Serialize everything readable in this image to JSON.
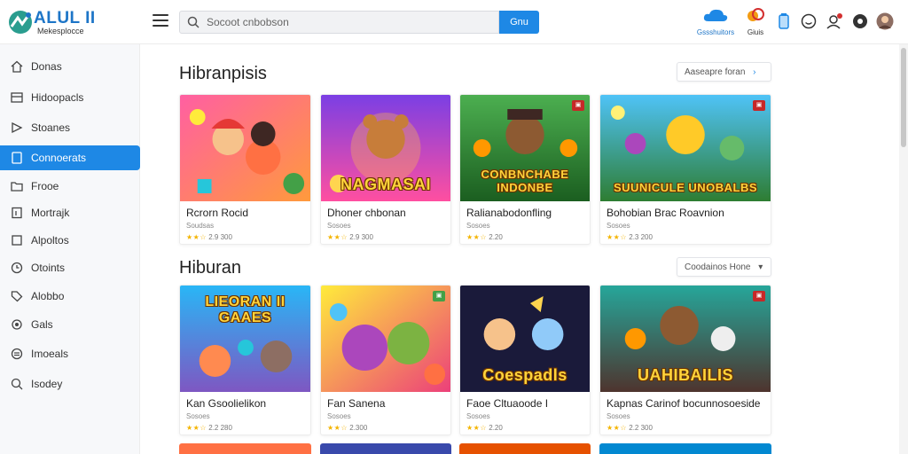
{
  "header": {
    "logo_title": "ALUL II",
    "logo_subtitle": "Mekesplocce",
    "search_placeholder": "Socoot cnbobson",
    "search_button": "Gnu",
    "cloud_label": "Gssshuitors",
    "coins_label": "Giuis"
  },
  "sidebar": {
    "items": [
      {
        "label": "Donas",
        "icon": "home-icon"
      },
      {
        "label": "Hidoopacls",
        "icon": "layout-icon"
      },
      {
        "label": "Stoanes",
        "icon": "arrow-icon"
      },
      {
        "label": "Connoerats",
        "icon": "tag-icon",
        "active": true
      },
      {
        "label": "Frooe",
        "icon": "folder-icon"
      },
      {
        "label": "Mortrajk",
        "icon": "bookmark-icon"
      },
      {
        "label": "Alpoltos",
        "icon": "square-icon"
      },
      {
        "label": "Otoints",
        "icon": "clock-icon"
      },
      {
        "label": "Alobbo",
        "icon": "tag-icon"
      },
      {
        "label": "Gals",
        "icon": "gear-icon"
      },
      {
        "label": "Imoeals",
        "icon": "list-icon"
      },
      {
        "label": "Isodey",
        "icon": "search-icon"
      }
    ]
  },
  "sections": [
    {
      "title": "Hibranpisis",
      "button": "Aaseapre foran",
      "cards": [
        {
          "name": "Rcrorn Rocid",
          "sub": "Soudsas",
          "rating": "2.9 300",
          "stars": "★★☆",
          "art_text": ""
        },
        {
          "name": "Dhoner chbonan",
          "sub": "Sosoes",
          "rating": "2.9 300",
          "stars": "★★☆",
          "art_text": "NAGMASAI"
        },
        {
          "name": "Ralianabodonfling",
          "sub": "Sosoes",
          "rating": "2.20",
          "stars": "★★☆",
          "art_text": "CONBNCHABE INDONBE"
        },
        {
          "name": "Bohobian Brac Roavnion",
          "sub": "Sosoes",
          "rating": "2.3 200",
          "stars": "★★☆",
          "art_text": "SUUNICULE UNOBALBS"
        }
      ]
    },
    {
      "title": "Hiburan",
      "button": "Coodainos Hone",
      "cards": [
        {
          "name": "Kan Gsoolielikon",
          "sub": "Sosoes",
          "rating": "2.2 280",
          "stars": "★★☆",
          "art_text": "LIEORAN II GAAES"
        },
        {
          "name": "Fan Sanena",
          "sub": "Sosoes",
          "rating": "2.300",
          "stars": "★★☆",
          "art_text": ""
        },
        {
          "name": "Faoe Cltuaoode I",
          "sub": "Sosoes",
          "rating": "2.20",
          "stars": "★★☆",
          "art_text": "Coespadls"
        },
        {
          "name": "Kapnas Carinof bocunnosoeside",
          "sub": "Sosoes",
          "rating": "2.2 300",
          "stars": "★★☆",
          "art_text": "UAHIBAILIS"
        }
      ]
    }
  ],
  "colors": {
    "accent": "#1e88e5",
    "star": "#f4b400"
  }
}
